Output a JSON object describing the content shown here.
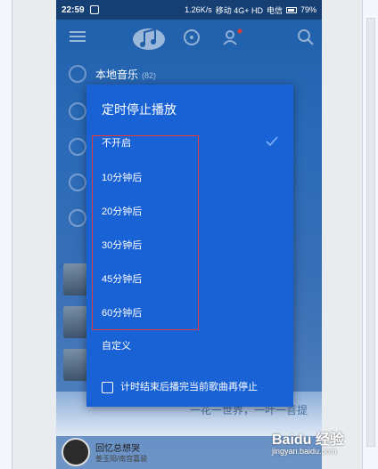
{
  "status_bar": {
    "time": "22:59",
    "network_speed": "1.26K/s",
    "carrier1": "移动 4G+ HD",
    "carrier2": "电信",
    "battery": "79%"
  },
  "menu": {
    "local_music_label": "本地音乐",
    "local_music_count": "(82)"
  },
  "now_playing": {
    "title": "回忆总想哭",
    "artist": "姜玉阳/南宫嘉骏"
  },
  "background_text": "一花一世界，一叶一菩提",
  "dialog": {
    "title": "定时停止播放",
    "options": [
      {
        "label": "不开启",
        "selected": true
      },
      {
        "label": "10分钟后",
        "selected": false
      },
      {
        "label": "20分钟后",
        "selected": false
      },
      {
        "label": "30分钟后",
        "selected": false
      },
      {
        "label": "45分钟后",
        "selected": false
      },
      {
        "label": "60分钟后",
        "selected": false
      },
      {
        "label": "自定义",
        "selected": false
      }
    ],
    "footer_checkbox_label": "计时结束后播完当前歌曲再停止",
    "footer_checked": false
  },
  "watermark": {
    "brand": "Baidu 经验",
    "url": "jingyan.baidu.com"
  },
  "colors": {
    "dialog_bg": "#1962d6",
    "highlight_border": "#e33a3a",
    "check_color": "#7fb2ff"
  }
}
